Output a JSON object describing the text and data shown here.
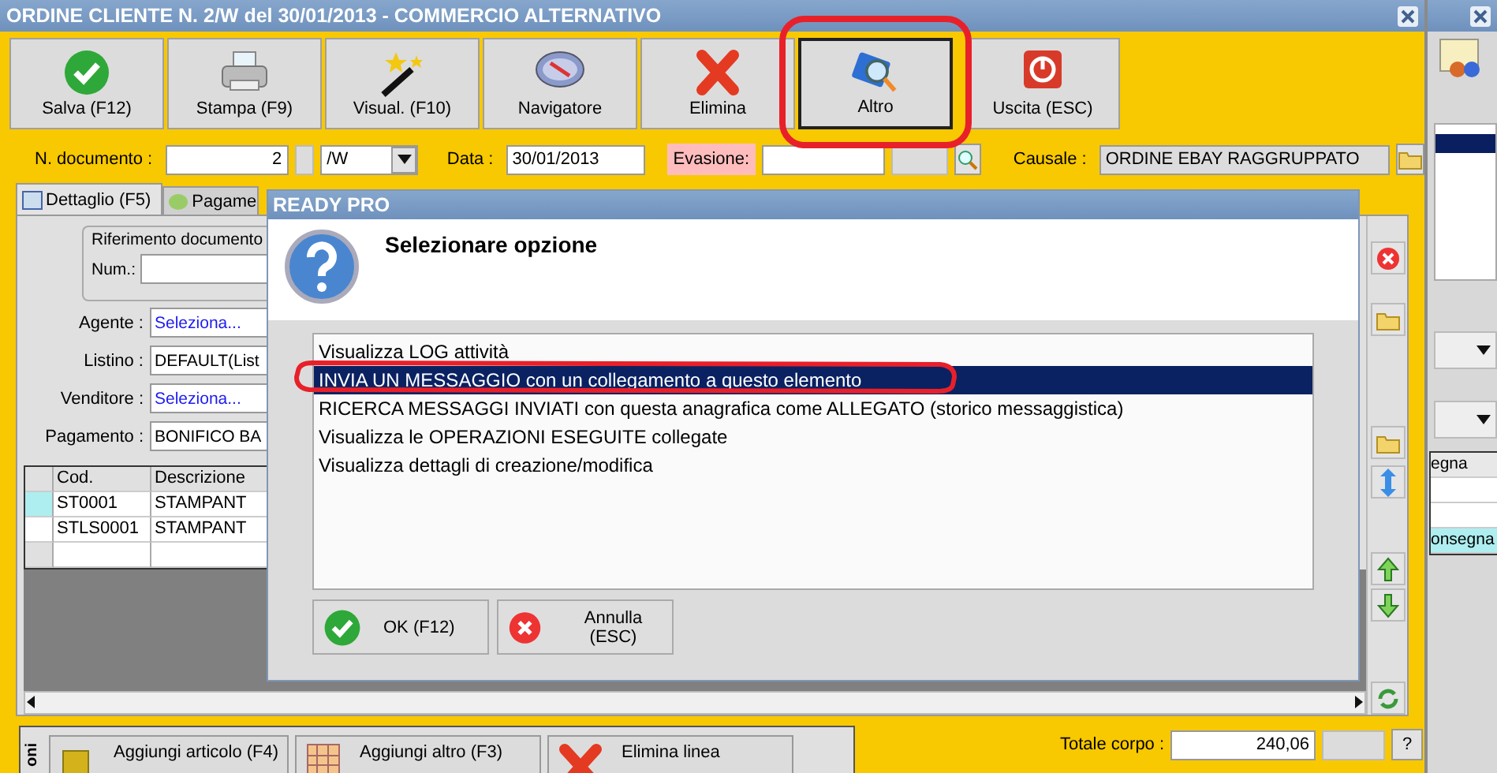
{
  "window": {
    "title": "ORDINE CLIENTE N. 2/W del 30/01/2013 - COMMERCIO ALTERNATIVO"
  },
  "toolbar": [
    {
      "label": "Salva (F12)",
      "kind": "save",
      "selected": false
    },
    {
      "label": "Stampa (F9)",
      "kind": "print",
      "selected": false
    },
    {
      "label": "Visual. (F10)",
      "kind": "wand",
      "selected": false
    },
    {
      "label": "Navigatore",
      "kind": "compass",
      "selected": false
    },
    {
      "label": "Elimina",
      "kind": "delete",
      "selected": false
    },
    {
      "label": "Altro",
      "kind": "search",
      "selected": true
    },
    {
      "label": "Uscita (ESC)",
      "kind": "power",
      "selected": false
    }
  ],
  "header": {
    "number_label": "N. documento :",
    "number": "2",
    "series": "/W",
    "date_label": "Data :",
    "date": "30/01/2013",
    "evasion_label": "Evasione:",
    "reason_label": "Causale :",
    "reason": "ORDINE EBAY RAGGRUPPATO"
  },
  "tabs": [
    {
      "label": "Dettaglio (F5)",
      "selected": true
    },
    {
      "label": "Pagame",
      "selected": false
    }
  ],
  "form": {
    "group_title": "Riferimento documento",
    "num_label": "Num.:",
    "fields": [
      {
        "label": "Agente :",
        "placeholder": "Seleziona..."
      },
      {
        "label": "Listino :",
        "value": "DEFAULT(List"
      },
      {
        "label": "Venditore :",
        "placeholder": "Seleziona..."
      },
      {
        "label": "Pagamento :",
        "value": "BONIFICO BA"
      }
    ]
  },
  "grid": {
    "columns": [
      "Cod.",
      "Descrizione"
    ],
    "rows": [
      {
        "cells": [
          "ST0001",
          "STAMPANT"
        ],
        "selected": true
      },
      {
        "cells": [
          "STLS0001",
          "STAMPANT"
        ],
        "selected": false
      }
    ]
  },
  "bottom": {
    "section_label": "oni",
    "buttons": [
      {
        "label": "Aggiungi articolo (F4)",
        "kind": "box"
      },
      {
        "label": "Aggiungi altro (F3)",
        "kind": "grid"
      },
      {
        "label": "Elimina linea",
        "kind": "delete"
      }
    ],
    "total_label": "Totale corpo :",
    "total": "240,06",
    "help": "?"
  },
  "side_window": {
    "header": "egna",
    "cells": [
      {
        "text": "",
        "selected": false
      },
      {
        "text": "",
        "selected": false
      },
      {
        "text": "onsegna",
        "selected": true
      }
    ]
  },
  "dialog": {
    "title": "READY PRO",
    "heading": "Selezionare opzione",
    "options": [
      {
        "label": "Visualizza LOG attività",
        "selected": false
      },
      {
        "label": "INVIA UN MESSAGGIO con un collegamento a questo elemento",
        "selected": true
      },
      {
        "label": "RICERCA MESSAGGI INVIATI con questa anagrafica come ALLEGATO (storico messaggistica)",
        "selected": false
      },
      {
        "label": "Visualizza le OPERAZIONI ESEGUITE collegate",
        "selected": false
      },
      {
        "label": "Visualizza dettagli di creazione/modifica",
        "selected": false
      }
    ],
    "buttons": [
      {
        "label": "OK (F12)",
        "kind": "ok"
      },
      {
        "label": "Annulla (ESC)",
        "kind": "cancel"
      }
    ]
  }
}
